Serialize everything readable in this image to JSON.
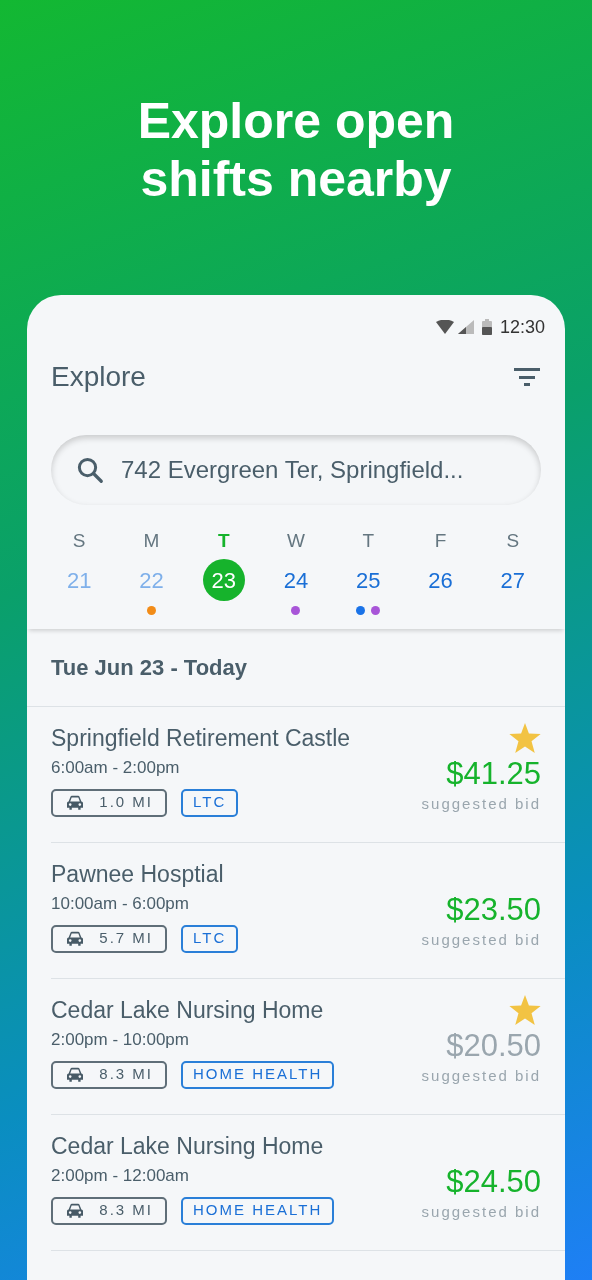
{
  "headline": "Explore open shifts nearby",
  "status_bar": {
    "time": "12:30"
  },
  "header": {
    "title": "Explore"
  },
  "search": {
    "value": "742 Evergreen Ter, Springfield..."
  },
  "calendar": {
    "days": [
      {
        "weekday": "S",
        "date": "21",
        "past": true,
        "selected": false
      },
      {
        "weekday": "M",
        "date": "22",
        "past": true,
        "selected": false,
        "dots": [
          {
            "color": "#f28c18"
          }
        ]
      },
      {
        "weekday": "T",
        "date": "23",
        "past": false,
        "selected": true
      },
      {
        "weekday": "W",
        "date": "24",
        "past": false,
        "selected": false,
        "dots": [
          {
            "color": "#a855d8"
          }
        ]
      },
      {
        "weekday": "T",
        "date": "25",
        "past": false,
        "selected": false,
        "dots": [
          {
            "color": "#1a73e8"
          },
          {
            "color": "#a855d8"
          }
        ]
      },
      {
        "weekday": "F",
        "date": "26",
        "past": false,
        "selected": false
      },
      {
        "weekday": "S",
        "date": "27",
        "past": false,
        "selected": false
      }
    ]
  },
  "section_title": "Tue Jun 23 - Today",
  "shifts": [
    {
      "name": "Springfield Retirement Castle",
      "time": "6:00am - 2:00pm",
      "distance": "1.0 MI",
      "tag": "LTC",
      "starred": true,
      "price": "$41.25",
      "dimmed": false,
      "price_note": "suggested bid"
    },
    {
      "name": "Pawnee Hosptial",
      "time": "10:00am - 6:00pm",
      "distance": "5.7 MI",
      "tag": "LTC",
      "starred": false,
      "price": "$23.50",
      "dimmed": false,
      "price_note": "suggested bid"
    },
    {
      "name": "Cedar Lake Nursing Home",
      "time": "2:00pm - 10:00pm",
      "distance": "8.3 MI",
      "tag": "HOME HEALTH",
      "starred": true,
      "price": "$20.50",
      "dimmed": true,
      "price_note": "suggested bid"
    },
    {
      "name": "Cedar Lake Nursing Home",
      "time": "2:00pm - 12:00am",
      "distance": "8.3 MI",
      "tag": "HOME HEALTH",
      "starred": false,
      "price": "$24.50",
      "dimmed": false,
      "price_note": "suggested bid"
    }
  ]
}
